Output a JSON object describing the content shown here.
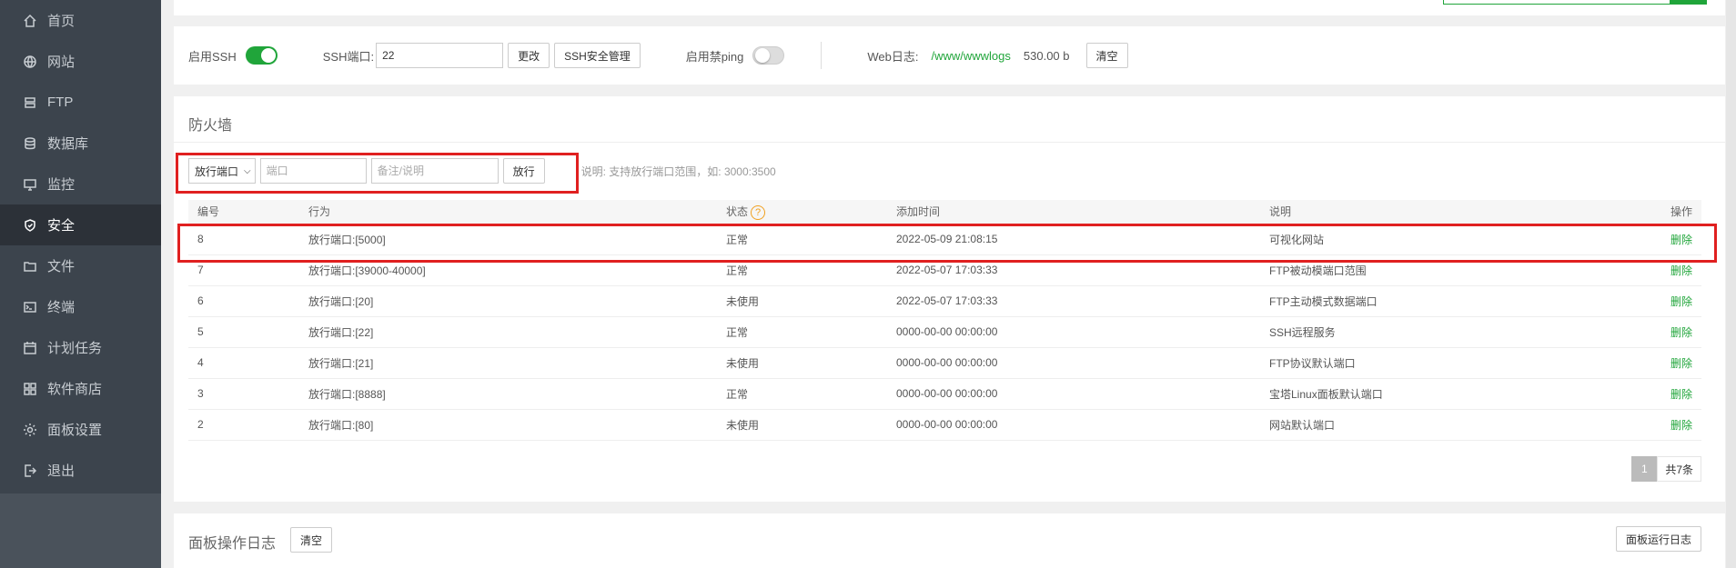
{
  "sidebar": {
    "items": [
      {
        "label": "首页",
        "icon": "home-icon"
      },
      {
        "label": "网站",
        "icon": "globe-icon"
      },
      {
        "label": "FTP",
        "icon": "ftp-icon"
      },
      {
        "label": "数据库",
        "icon": "database-icon"
      },
      {
        "label": "监控",
        "icon": "monitor-icon"
      },
      {
        "label": "安全",
        "icon": "shield-icon",
        "active": true
      },
      {
        "label": "文件",
        "icon": "folder-icon"
      },
      {
        "label": "终端",
        "icon": "terminal-icon"
      },
      {
        "label": "计划任务",
        "icon": "calendar-icon"
      },
      {
        "label": "软件商店",
        "icon": "apps-icon"
      },
      {
        "label": "面板设置",
        "icon": "gear-icon"
      },
      {
        "label": "退出",
        "icon": "logout-icon"
      }
    ]
  },
  "ssh_bar": {
    "ssh_label": "启用SSH",
    "ssh_enabled": true,
    "port_label": "SSH端口:",
    "port_value": "22",
    "change_button": "更改",
    "manage_button": "SSH安全管理",
    "ping_label": "启用禁ping",
    "ping_enabled": false,
    "weblog_label": "Web日志:",
    "weblog_path": "/www/wwwlogs",
    "weblog_size": "530.00 b",
    "clear_button": "清空"
  },
  "firewall": {
    "title": "防火墙",
    "select_value": "放行端口",
    "port_placeholder": "端口",
    "note_placeholder": "备注/说明",
    "allow_button": "放行",
    "hint": "说明: 支持放行端口范围，如: 3000:3500",
    "columns": {
      "id": "编号",
      "action": "行为",
      "status": "状态",
      "time": "添加时间",
      "desc": "说明",
      "op": "操作"
    },
    "status_help_icon": "?",
    "rows": [
      {
        "id": "8",
        "action": "放行端口:[5000]",
        "status": "正常",
        "time": "2022-05-09 21:08:15",
        "desc": "可视化网站",
        "op": "删除"
      },
      {
        "id": "7",
        "action": "放行端口:[39000-40000]",
        "status": "正常",
        "time": "2022-05-07 17:03:33",
        "desc": "FTP被动模端口范围",
        "op": "删除"
      },
      {
        "id": "6",
        "action": "放行端口:[20]",
        "status": "未使用",
        "time": "2022-05-07 17:03:33",
        "desc": "FTP主动模式数据端口",
        "op": "删除"
      },
      {
        "id": "5",
        "action": "放行端口:[22]",
        "status": "正常",
        "time": "0000-00-00 00:00:00",
        "desc": "SSH远程服务",
        "op": "删除"
      },
      {
        "id": "4",
        "action": "放行端口:[21]",
        "status": "未使用",
        "time": "0000-00-00 00:00:00",
        "desc": "FTP协议默认端口",
        "op": "删除"
      },
      {
        "id": "3",
        "action": "放行端口:[8888]",
        "status": "正常",
        "time": "0000-00-00 00:00:00",
        "desc": "宝塔Linux面板默认端口",
        "op": "删除"
      },
      {
        "id": "2",
        "action": "放行端口:[80]",
        "status": "未使用",
        "time": "0000-00-00 00:00:00",
        "desc": "网站默认端口",
        "op": "删除"
      }
    ],
    "pager": {
      "current": "1",
      "total": "共7条"
    }
  },
  "panel_log": {
    "title": "面板操作日志",
    "clear_button": "清空",
    "run_log_button": "面板运行日志"
  },
  "colors": {
    "accent": "#20a53a",
    "sidebar_bg": "#3c444d",
    "highlight": "#e02020",
    "help_icon": "#f0a020"
  }
}
